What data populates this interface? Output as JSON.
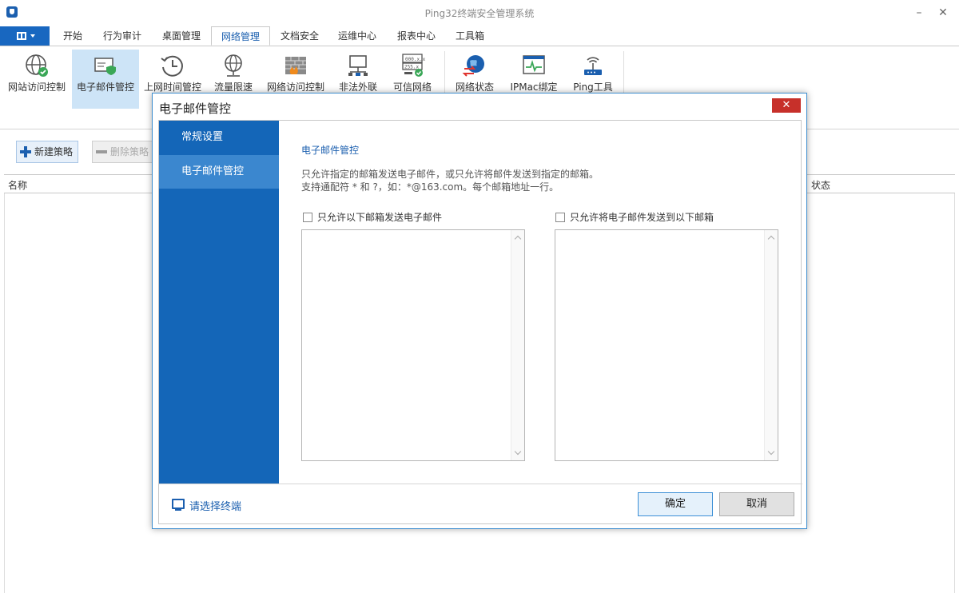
{
  "app": {
    "title": "Ping32终端安全管理系统"
  },
  "window_controls": {
    "minimize": "–",
    "close": "✕"
  },
  "menu_tabs": [
    {
      "label": "开始"
    },
    {
      "label": "行为审计"
    },
    {
      "label": "桌面管理"
    },
    {
      "label": "网络管理",
      "active": true
    },
    {
      "label": "文档安全"
    },
    {
      "label": "运维中心"
    },
    {
      "label": "报表中心"
    },
    {
      "label": "工具箱"
    }
  ],
  "ribbon": [
    {
      "label": "网站访问控制",
      "icon": "globe-check-icon"
    },
    {
      "label": "电子邮件管控",
      "icon": "mail-shield-icon",
      "active": true
    },
    {
      "label": "上网时间管控",
      "icon": "clock-history-icon"
    },
    {
      "label": "流量限速",
      "icon": "globe-network-icon"
    },
    {
      "label": "网络访问控制",
      "icon": "firewall-icon"
    },
    {
      "label": "非法外联",
      "icon": "monitor-network-icon"
    },
    {
      "label": "可信网络",
      "icon": "ip-check-icon"
    },
    {
      "label": "网络状态",
      "icon": "globe-arrows-icon"
    },
    {
      "label": "IPMac绑定",
      "icon": "pulse-window-icon"
    },
    {
      "label": "Ping工具",
      "icon": "router-wifi-icon"
    }
  ],
  "toolbar": {
    "new_policy": "新建策略",
    "delete_policy": "删除策略"
  },
  "grid": {
    "col_name": "名称",
    "col_status": "状态"
  },
  "dialog": {
    "title": "电子邮件管控",
    "close": "✕",
    "nav": [
      {
        "label": "常规设置"
      },
      {
        "label": "电子邮件管控",
        "active": true
      }
    ],
    "section_title": "电子邮件管控",
    "desc_line1": "只允许指定的邮箱发送电子邮件，或只允许将邮件发送到指定的邮箱。",
    "desc_line2": "支持通配符 * 和 ?，如：*@163.com。每个邮箱地址一行。",
    "allow_send_label": "只允许以下邮箱发送电子邮件",
    "allow_send_checked": false,
    "allow_send_list": "",
    "allow_recv_label": "只允许将电子邮件发送到以下邮箱",
    "allow_recv_checked": false,
    "allow_recv_list": "",
    "select_terminal": "请选择终端",
    "ok": "确定",
    "cancel": "取消"
  },
  "colors": {
    "accent": "#1466b8",
    "nav_active": "#3b87cf",
    "close_red": "#c7302a"
  }
}
